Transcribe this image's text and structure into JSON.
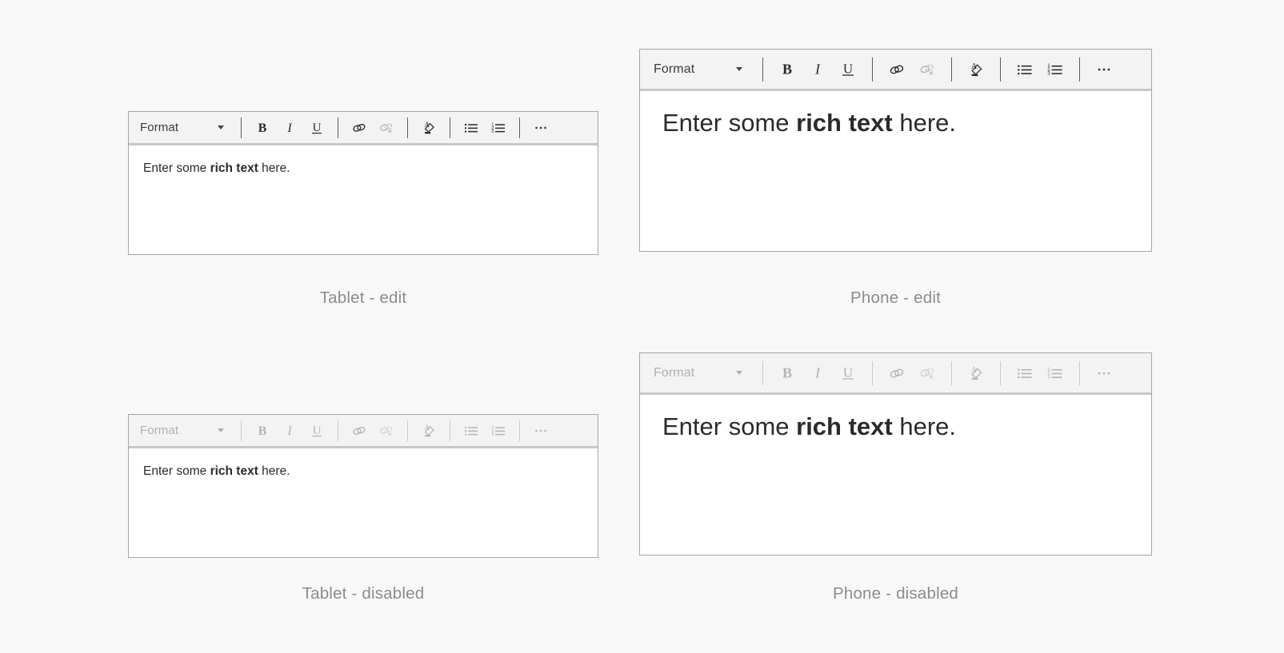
{
  "page": {
    "background_color": "#f8f8f8",
    "panel_border_color": "#a6a6a6",
    "toolbar_background": "#f3f3f3",
    "caption_color": "#8c8c8c",
    "icon_color": "#2b2b2b",
    "icon_disabled_color": "#b4b4b4"
  },
  "toolbar": {
    "format_label": "Format",
    "buttons": [
      {
        "name": "bold-button",
        "icon": "bold-icon",
        "label": "B",
        "state": "enabled"
      },
      {
        "name": "italic-button",
        "icon": "italic-icon",
        "label": "I",
        "state": "enabled"
      },
      {
        "name": "underline-button",
        "icon": "underline-icon",
        "label": "U",
        "state": "enabled"
      },
      {
        "name": "insert-link-button",
        "icon": "link-icon",
        "label": "Link",
        "state": "enabled"
      },
      {
        "name": "remove-link-button",
        "icon": "unlink-icon",
        "label": "Unlink",
        "state": "dimmed"
      },
      {
        "name": "clear-formatting-button",
        "icon": "clear-formatting-icon",
        "label": "Clear formatting",
        "state": "enabled"
      },
      {
        "name": "bulleted-list-button",
        "icon": "bulleted-list-icon",
        "label": "Bulleted list",
        "state": "enabled"
      },
      {
        "name": "numbered-list-button",
        "icon": "numbered-list-icon",
        "label": "Numbered list",
        "state": "enabled"
      },
      {
        "name": "more-options-button",
        "icon": "ellipsis-icon",
        "label": "More options",
        "state": "enabled"
      }
    ]
  },
  "body_text": {
    "lead": "Enter some ",
    "bold": "rich text",
    "tail": " here."
  },
  "panels": [
    {
      "id": "tablet-edit",
      "device": "tablet",
      "state": "edit",
      "caption": "Tablet - edit"
    },
    {
      "id": "phone-edit",
      "device": "phone",
      "state": "edit",
      "caption": "Phone - edit"
    },
    {
      "id": "tablet-disabled",
      "device": "tablet",
      "state": "disabled",
      "caption": "Tablet - disabled"
    },
    {
      "id": "phone-disabled",
      "device": "phone",
      "state": "disabled",
      "caption": "Phone - disabled"
    }
  ]
}
